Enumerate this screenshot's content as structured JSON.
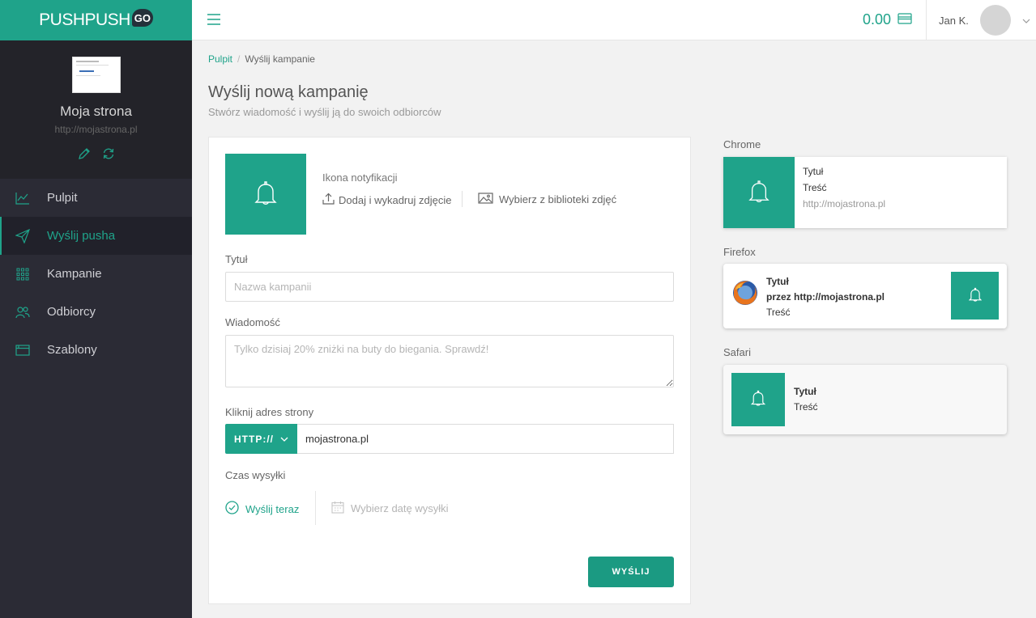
{
  "brand": {
    "name": "PUSHPUSH",
    "badge": "GO",
    "color": "#1fa38a"
  },
  "site": {
    "name": "Moja strona",
    "url": "http://mojastrona.pl"
  },
  "nav": [
    {
      "label": "Pulpit",
      "icon": "chart-line-icon",
      "active": false
    },
    {
      "label": "Wyślij pusha",
      "icon": "paper-plane-icon",
      "active": true
    },
    {
      "label": "Kampanie",
      "icon": "grid-icon",
      "active": false
    },
    {
      "label": "Odbiorcy",
      "icon": "users-icon",
      "active": false
    },
    {
      "label": "Szablony",
      "icon": "browser-window-icon",
      "active": false
    }
  ],
  "topbar": {
    "balance": "0.00",
    "user_name": "Jan K."
  },
  "breadcrumb": {
    "home": "Pulpit",
    "current": "Wyślij kampanie"
  },
  "page": {
    "title": "Wyślij nową kampanię",
    "subtitle": "Stwórz wiadomość i wyślij ją do swoich odbiorców"
  },
  "form": {
    "icon_label": "Ikona notyfikacji",
    "upload_label": "Dodaj i wykadruj zdjęcie",
    "library_label": "Wybierz z biblioteki zdjęć",
    "title_label": "Tytuł",
    "title_placeholder": "Nazwa kampanii",
    "message_label": "Wiadomość",
    "message_placeholder": "Tylko dzisiaj 20% zniżki na buty do biegania. Sprawdź!",
    "url_label": "Kliknij adres strony",
    "protocol": "HTTP://",
    "url_value": "mojastrona.pl",
    "time_label": "Czas wysyłki",
    "send_now": "Wyślij teraz",
    "pick_date": "Wybierz datę wysyłki",
    "submit": "WYŚLIJ"
  },
  "previews": {
    "chrome": {
      "label": "Chrome",
      "title": "Tytuł",
      "body": "Treść",
      "url": "http://mojastrona.pl"
    },
    "firefox": {
      "label": "Firefox",
      "title": "Tytuł",
      "via": "przez http://mojastrona.pl",
      "body": "Treść"
    },
    "safari": {
      "label": "Safari",
      "title": "Tytuł",
      "body": "Treść"
    }
  }
}
